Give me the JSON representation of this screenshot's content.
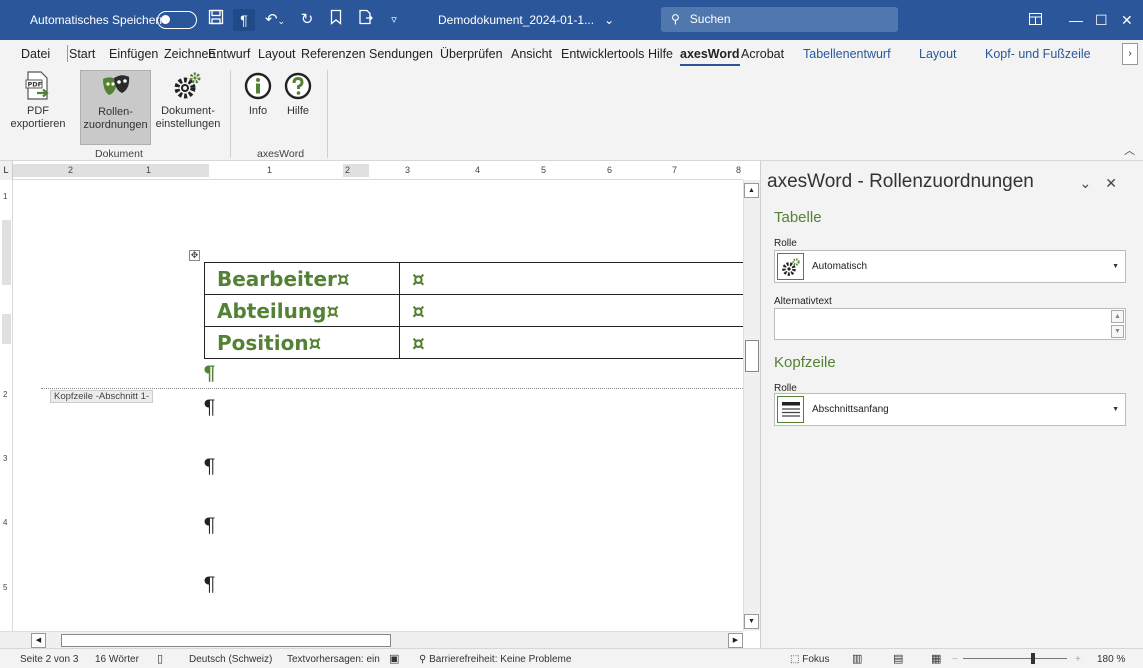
{
  "titlebar": {
    "autosave_label": "Automatisches Speichern",
    "doc_name": "Demodokument_2024-01-1...",
    "doc_chevron": "⌄",
    "search_placeholder": "Suchen",
    "bg_color": "#2b579a"
  },
  "tabs": {
    "file": "Datei",
    "items": [
      "Start",
      "Einfügen",
      "Zeichnen",
      "Entwurf",
      "Layout",
      "Referenzen",
      "Sendungen",
      "Überprüfen",
      "Ansicht",
      "Entwicklertools",
      "Hilfe",
      "axesWord",
      "Acrobat"
    ],
    "active": "axesWord",
    "contextual": [
      "Tabellenentwurf",
      "Layout",
      "Kopf- und Fußzeile"
    ],
    "contextual_color": "#2b579a"
  },
  "ribbon": {
    "groups": [
      {
        "label": "Dokument",
        "buttons": [
          {
            "line1": "PDF",
            "line2": "exportieren",
            "icon": "pdf-export-icon"
          },
          {
            "line1": "Rollen-",
            "line2": "zuordnungen",
            "icon": "masks-icon",
            "selected": true
          },
          {
            "line1": "Dokument-",
            "line2": "einstellungen",
            "icon": "gear-settings-icon"
          }
        ]
      },
      {
        "label": "axesWord",
        "buttons": [
          {
            "line1": "Info",
            "icon": "info-icon"
          },
          {
            "line1": "Hilfe",
            "icon": "help-icon"
          }
        ]
      }
    ]
  },
  "ruler": {
    "h_numbers": [
      "2",
      "1",
      "1",
      "2",
      "3",
      "4",
      "5",
      "6",
      "7",
      "8"
    ],
    "v_numbers": [
      "1",
      "2",
      "3",
      "4",
      "5"
    ]
  },
  "document": {
    "table": [
      {
        "label": "Bearbeiter¤",
        "value": "¤"
      },
      {
        "label": "Abteilung¤",
        "value": "¤"
      },
      {
        "label": "Position¤",
        "value": "¤"
      }
    ],
    "pilcrow": "¶",
    "header_label": "Kopfzeile -Abschnitt 1-",
    "heading_color": "#548235"
  },
  "pane": {
    "title": "axesWord - Rollenzuordnungen",
    "sections": [
      {
        "heading": "Tabelle",
        "role_label": "Rolle",
        "role_value": "Automatisch",
        "alt_label": "Alternativtext",
        "alt_value": ""
      },
      {
        "heading": "Kopfzeile",
        "role_label": "Rolle",
        "role_value": "Abschnittsanfang"
      }
    ]
  },
  "statusbar": {
    "page": "Seite 2 von 3",
    "words": "16 Wörter",
    "language": "Deutsch (Schweiz)",
    "predictions": "Textvorhersagen: ein",
    "accessibility": "Barrierefreiheit: Keine Probleme",
    "focus": "Fokus",
    "zoom": "180 %",
    "zoom_minus": "−",
    "zoom_plus": "+"
  }
}
